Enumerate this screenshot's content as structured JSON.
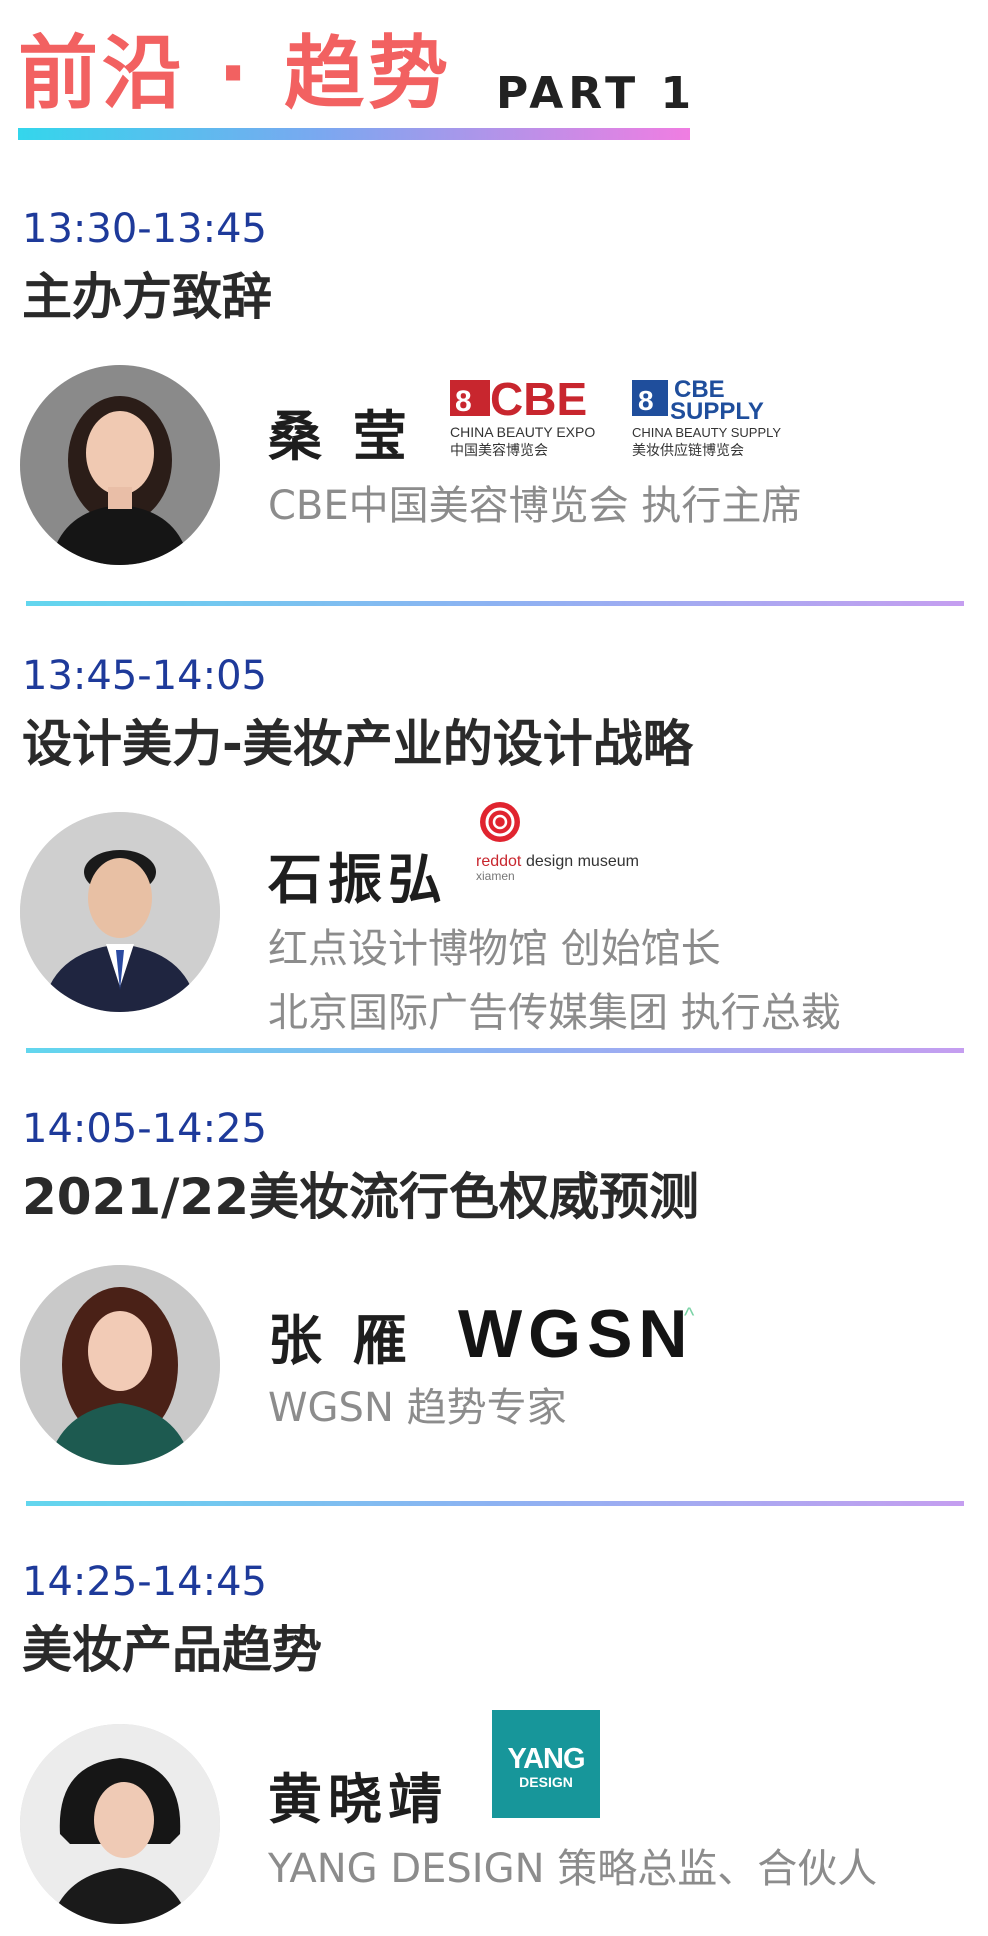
{
  "header": {
    "title": "前沿 · 趋势",
    "part": "PART 1"
  },
  "sessions": [
    {
      "time": "13:30-13:45",
      "topic": "主办方致辞",
      "speaker": "桑 莹",
      "roles": [
        "CBE中国美容博览会 执行主席"
      ],
      "logos": {
        "cbe": {
          "mark": "CBE",
          "en": "CHINA BEAUTY EXPO",
          "cn": "中国美容博览会"
        },
        "cbe_supply": {
          "mark_top": "CBE",
          "mark_bottom": "SUPPLY",
          "en": "CHINA BEAUTY SUPPLY",
          "cn": "美妆供应链博览会"
        }
      }
    },
    {
      "time": "13:45-14:05",
      "topic": "设计美力-美妆产业的设计战略",
      "speaker": "石振弘",
      "roles": [
        "红点设计博物馆 创始馆长",
        "北京国际广告传媒集团 执行总裁"
      ],
      "logos": {
        "reddot": {
          "red": "reddot",
          "rest": " design museum",
          "sub": "xiamen"
        }
      }
    },
    {
      "time": "14:05-14:25",
      "topic": "2021/22美妆流行色权威预测",
      "speaker": "张 雁",
      "roles": [
        "WGSN 趋势专家"
      ],
      "logos": {
        "wgsn": {
          "text": "WGSN",
          "caret": "^"
        }
      }
    },
    {
      "time": "14:25-14:45",
      "topic": "美妆产品趋势",
      "speaker": "黄晓靖",
      "roles": [
        "YANG DESIGN 策略总监、合伙人"
      ],
      "logos": {
        "yang": {
          "big": "YANG",
          "small": "DESIGN"
        }
      }
    }
  ],
  "colors": {
    "title": "#f26161",
    "time": "#1e3a9a",
    "role": "#8c8c8c",
    "cbe_red": "#c8262e",
    "cbe_blue": "#1f4e9c",
    "yang_teal": "#17969a"
  }
}
